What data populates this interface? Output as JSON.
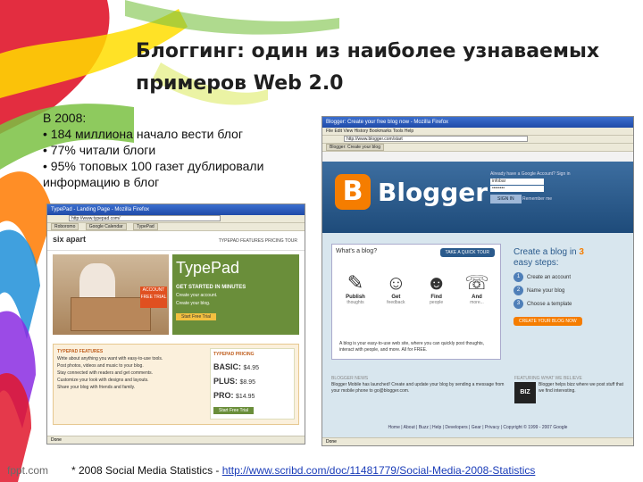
{
  "slide": {
    "title_line1": "Блоггинг: один из наиболее узнаваемых",
    "title_line2": "примеров Web 2.0",
    "stats": [
      "В 2008:",
      "• 184 миллиона начало вести блог",
      "• 77% читали блоги",
      "• 95% топовых 100 газет дублировали",
      "информацию в блог"
    ],
    "footnote_text": "* 2008 Social Media Statistics - ",
    "footnote_link": "http://www.scribd.com/doc/11481779/Social-Media-2008-Statistics",
    "brand": "fppt.com"
  },
  "blogger_window": {
    "title": "Blogger: Create your free blog now - Mozilla Firefox",
    "menu": "File  Edit  View  History  Bookmarks  Tools  Help",
    "address": "http://www.blogger.com/start",
    "tabs": [
      "Blogger: Create your blog"
    ],
    "logo_letter": "B",
    "logo_text": "Blogger",
    "login_label": "Already have a Google Account? Sign in",
    "username": "infobar",
    "password": "••••••••",
    "signin": "SIGN IN",
    "remember": "Remember me",
    "whats_blog": "What's a blog?",
    "quick_tour": "TAKE A QUICK TOUR",
    "icons": [
      {
        "glyph": "✎",
        "label": "Publish",
        "sub": "thoughts"
      },
      {
        "glyph": "☺",
        "label": "Get",
        "sub": "feedback"
      },
      {
        "glyph": "☻",
        "label": "Find",
        "sub": "people"
      },
      {
        "glyph": "☏",
        "label": "And",
        "sub": "more..."
      }
    ],
    "description": "A blog is your easy-to-use web site, where you can quickly post thoughts, interact with people, and more. All for FREE.",
    "steps_head": "Create a blog in",
    "steps_num": "3",
    "steps_tail": "easy steps:",
    "steps": [
      "Create an account",
      "Name your blog",
      "Choose a template"
    ],
    "create": "CREATE YOUR BLOG NOW",
    "news_label": "BLOGGER NEWS",
    "news": "Blogger Mobile has launched! Create and update your blog by sending a message from your mobile phone to go@blogger.com.",
    "feat_label": "FEATURING WHAT WE BELIEVE",
    "feat_logo": "BIZ",
    "feat": "Blogger helps bizz where we post stuff that we find interesting.",
    "footer": "Home | About | Buzz | Help | Developers | Gear | Privacy | Copyright © 1999 - 2007 Google",
    "status": "Done"
  },
  "typepad_window": {
    "title": "TypePad - Landing Page - Mozilla Firefox",
    "menu": "File  Edit  View  History  Bookmarks  Tools  Help",
    "address": "http://www.typepad.com/",
    "tabs": [
      "Roboromo",
      "Google Calendar",
      "TypePad"
    ],
    "six_apart": "six apart",
    "nav": "TYPEPAD   FEATURES   PRICING   TOUR",
    "free_badge": "ACCOUNT FREE TRIAL",
    "logo": "TypePad",
    "get_started": "GET STARTED IN MINUTES",
    "create_account": "Create your account.",
    "create_blog": "Create your blog.",
    "trial": "Start Free Trial",
    "features_head": "TYPEPAD FEATURES",
    "features": [
      "Write about anything you want with easy-to-use tools.",
      "Post photos, videos and music to your blog.",
      "Stay connected with readers and get comments.",
      "Customize your look with designs and layouts.",
      "Share your blog with friends and family."
    ],
    "pricing_head": "TYPEPAD PRICING",
    "plans": [
      {
        "name": "BASIC:",
        "price": "$4.95"
      },
      {
        "name": "PLUS:",
        "price": "$8.95"
      },
      {
        "name": "PRO:",
        "price": "$14.95"
      }
    ],
    "start": "Start Free Trial",
    "status": "Done"
  }
}
